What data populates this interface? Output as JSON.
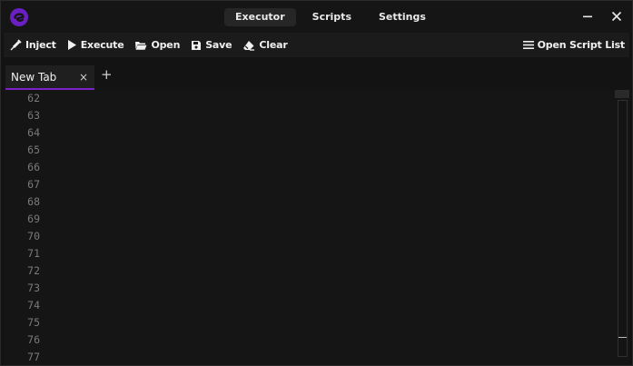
{
  "nav": {
    "tabs": [
      "Executor",
      "Scripts",
      "Settings"
    ],
    "active_index": 0
  },
  "window_controls": {
    "minimize_icon": "minimize-icon",
    "close_icon": "close-icon"
  },
  "toolbar": {
    "inject_label": "Inject",
    "execute_label": "Execute",
    "open_label": "Open",
    "save_label": "Save",
    "clear_label": "Clear",
    "script_list_label": "Open Script List"
  },
  "editor_tabs": [
    {
      "label": "New Tab",
      "close": "×"
    }
  ],
  "add_tab_label": "+",
  "editor": {
    "line_numbers": [
      "62",
      "63",
      "64",
      "65",
      "66",
      "67",
      "68",
      "69",
      "70",
      "71",
      "72",
      "73",
      "74",
      "75",
      "76",
      "77"
    ]
  },
  "colors": {
    "accent": "#7a22c8",
    "logo": "#6a1fc2",
    "background": "#131313",
    "toolbar": "#1b1b1b"
  }
}
